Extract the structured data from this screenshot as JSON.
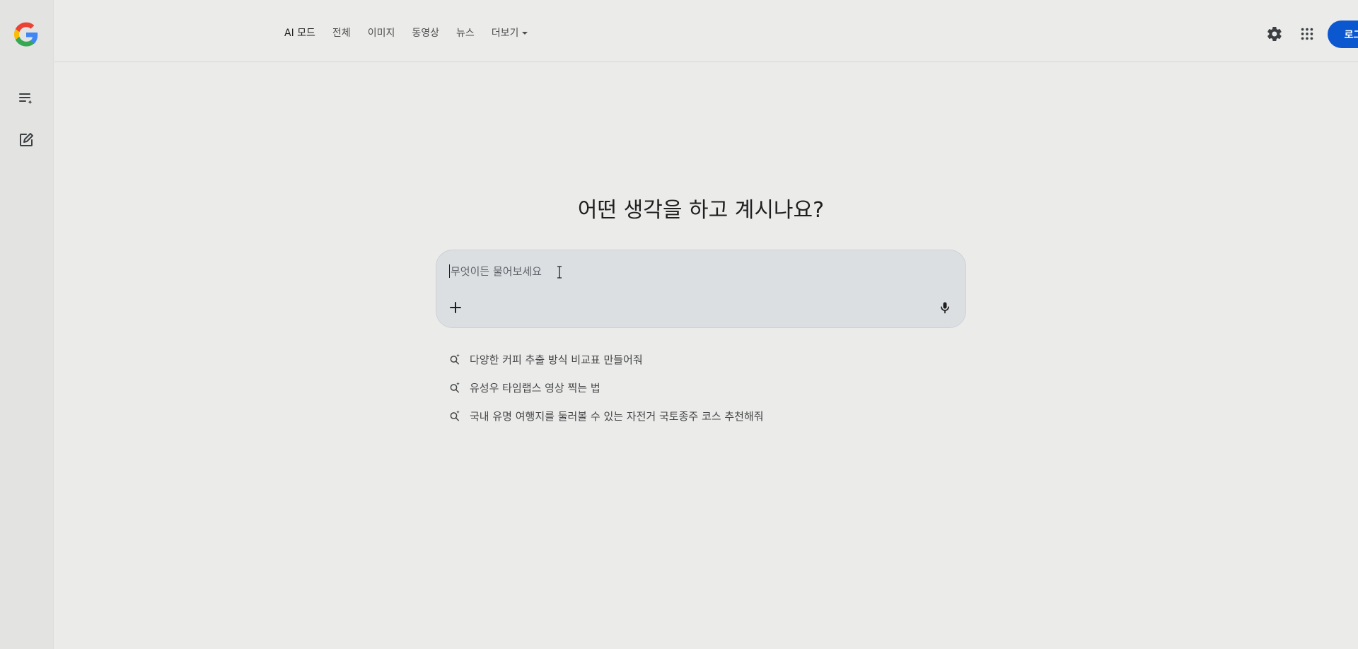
{
  "nav": {
    "tabs": [
      {
        "label": "AI 모드"
      },
      {
        "label": "전체"
      },
      {
        "label": "이미지"
      },
      {
        "label": "동영상"
      },
      {
        "label": "뉴스"
      },
      {
        "label": "더보기"
      }
    ]
  },
  "header": {
    "login_label": "로그인"
  },
  "main": {
    "heading": "어떤 생각을 하고 계시나요?",
    "search": {
      "placeholder": "무엇이든 물어보세요",
      "value": ""
    },
    "suggestions": [
      {
        "label": "다양한 커피 추출 방식 비교표 만들어줘"
      },
      {
        "label": "유성우 타임랩스 영상 찍는 법"
      },
      {
        "label": "국내 유명 여행지를 둘러볼 수 있는 자전거 국토종주 코스 추천해줘"
      }
    ]
  },
  "icons": {
    "logo": "google-g-logo",
    "history": "history-list-icon",
    "new_chat": "edit-icon",
    "settings": "gear-icon",
    "apps": "apps-grid-icon",
    "add": "plus-icon",
    "voice": "mic-icon",
    "suggestion": "sparkle-search-icon"
  },
  "colors": {
    "accent": "#0b57d0",
    "background": "#ebebea",
    "search_box": "#dcdfe2"
  }
}
